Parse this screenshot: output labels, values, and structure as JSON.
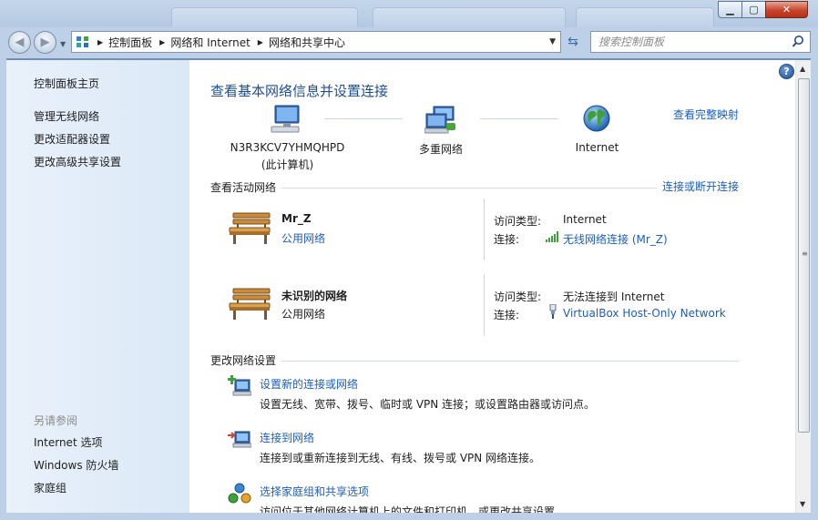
{
  "address": {
    "crumbs": [
      "控制面板",
      "网络和 Internet",
      "网络和共享中心"
    ]
  },
  "search": {
    "placeholder": "搜索控制面板"
  },
  "sidebar": {
    "home": "控制面板主页",
    "links": [
      "管理无线网络",
      "更改适配器设置",
      "更改高级共享设置"
    ],
    "see_also_heading": "另请参阅",
    "see_also": [
      "Internet 选项",
      "Windows 防火墙",
      "家庭组"
    ]
  },
  "main": {
    "title": "查看基本网络信息并设置连接",
    "full_map_link": "查看完整映射",
    "map": {
      "computer_name": "N3R3KCV7YHMQHPD",
      "computer_sub": "(此计算机)",
      "multi_network": "多重网络",
      "internet": "Internet"
    },
    "active_section": "查看活动网络",
    "connect_link": "连接或断开连接",
    "networks": [
      {
        "name": "Mr_Z",
        "type": "公用网络",
        "access_label": "访问类型:",
        "access_value": "Internet",
        "conn_label": "连接:",
        "conn_value": "无线网络连接 (Mr_Z)"
      },
      {
        "name": "未识别的网络",
        "type": "公用网络",
        "access_label": "访问类型:",
        "access_value": "无法连接到 Internet",
        "conn_label": "连接:",
        "conn_value": "VirtualBox Host-Only Network"
      }
    ],
    "change_section": "更改网络设置",
    "tasks": [
      {
        "title": "设置新的连接或网络",
        "desc": "设置无线、宽带、拨号、临时或 VPN 连接；或设置路由器或访问点。"
      },
      {
        "title": "连接到网络",
        "desc": "连接到或重新连接到无线、有线、拨号或 VPN 网络连接。"
      },
      {
        "title": "选择家庭组和共享选项",
        "desc": "访问位于其他网络计算机上的文件和打印机，或更改共享设置。"
      }
    ]
  },
  "colors": {
    "link": "#1e5ebc",
    "title": "#1e4e96",
    "sidebar": "#e3edf8",
    "frame": "#bdd0e7"
  }
}
